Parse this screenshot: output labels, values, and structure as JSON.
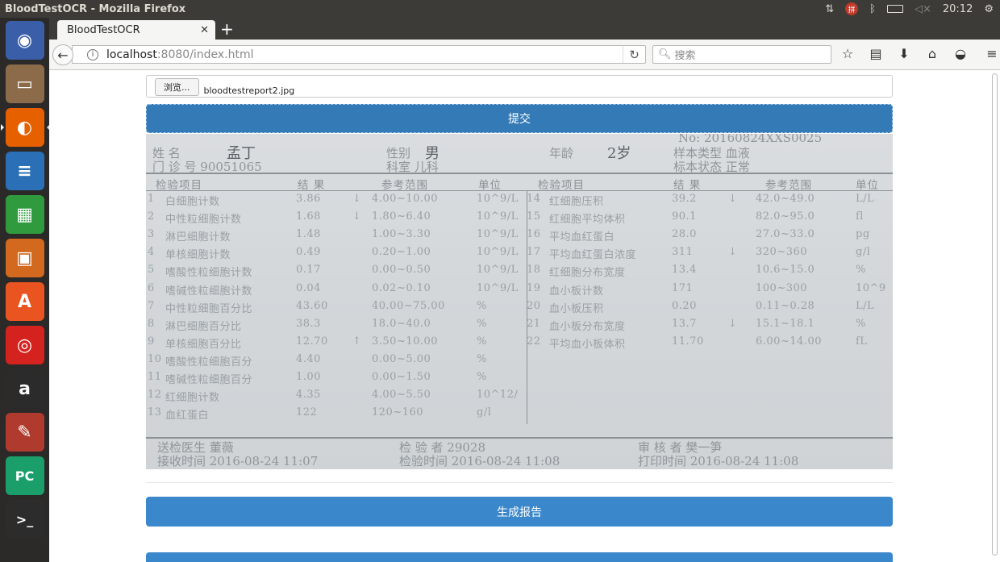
{
  "top_panel": {
    "window_title": "BloodTestOCR - Mozilla Firefox",
    "clock": "20:12",
    "indicators": [
      "network-icon",
      "input-method-icon",
      "bluetooth-icon",
      "battery-icon",
      "volume-muted-icon",
      "settings-gear-icon"
    ]
  },
  "launcher": {
    "apps": [
      {
        "name": "ubuntu-dash",
        "label": "◉",
        "color": "#3a5fa8"
      },
      {
        "name": "files",
        "label": "▭",
        "color": "#8b6b4a"
      },
      {
        "name": "firefox",
        "label": "◐",
        "color": "#e66000"
      },
      {
        "name": "libreoffice-writer",
        "label": "≡",
        "color": "#2b6fb6"
      },
      {
        "name": "libreoffice-calc",
        "label": "▦",
        "color": "#2f9b3e"
      },
      {
        "name": "libreoffice-impress",
        "label": "▣",
        "color": "#d2691e"
      },
      {
        "name": "ubuntu-software",
        "label": "A",
        "color": "#e95420"
      },
      {
        "name": "netease-music",
        "label": "◎",
        "color": "#d4231f"
      },
      {
        "name": "amazon",
        "label": "a",
        "color": "#2b2b2b"
      },
      {
        "name": "system-settings",
        "label": "✎",
        "color": "#b03a2e"
      },
      {
        "name": "pycharm",
        "label": "PC",
        "color": "#1a9f6b"
      },
      {
        "name": "terminal",
        "label": ">_",
        "color": "#2c2c2c"
      }
    ]
  },
  "browser": {
    "tab_title": "BloodTestOCR",
    "new_tab": "+",
    "url_host": "localhost",
    "url_rest": ":8080/index.html",
    "search_placeholder": "搜索"
  },
  "page": {
    "browse_label": "浏览...",
    "file_name": "bloodtestreport2.jpg",
    "submit_label": "提交",
    "generate_label": "生成报告"
  },
  "report_image": {
    "report_no": "No: 20160824XXS0025",
    "name_label": "姓    名",
    "name_value": "孟丁",
    "gender_label": "性别",
    "gender_value": "男",
    "age_label": "年龄",
    "age_value": "2岁",
    "sample_type": "样本类型 血液",
    "clinic_no": "门  诊  号 90051065",
    "department": "科室 儿科",
    "sample_status": "标本状态 正常",
    "headers": {
      "item": "检验项目",
      "result": "结    果",
      "range": "参考范围",
      "unit": "单位"
    },
    "left_rows": [
      {
        "no": "1",
        "name": "白细胞计数",
        "result": "3.86",
        "flag": "↓",
        "range": "4.00~10.00",
        "unit": "10^9/L"
      },
      {
        "no": "2",
        "name": "中性粒细胞计数",
        "result": "1.68",
        "flag": "↓",
        "range": "1.80~6.40",
        "unit": "10^9/L"
      },
      {
        "no": "3",
        "name": "淋巴细胞计数",
        "result": "1.48",
        "flag": "",
        "range": "1.00~3.30",
        "unit": "10^9/L"
      },
      {
        "no": "4",
        "name": "单核细胞计数",
        "result": "0.49",
        "flag": "",
        "range": "0.20~1.00",
        "unit": "10^9/L"
      },
      {
        "no": "5",
        "name": "嗜酸性粒细胞计数",
        "result": "0.17",
        "flag": "",
        "range": "0.00~0.50",
        "unit": "10^9/L"
      },
      {
        "no": "6",
        "name": "嗜碱性粒细胞计数",
        "result": "0.04",
        "flag": "",
        "range": "0.02~0.10",
        "unit": "10^9/L"
      },
      {
        "no": "7",
        "name": "中性粒细胞百分比",
        "result": "43.60",
        "flag": "",
        "range": "40.00~75.00",
        "unit": "%"
      },
      {
        "no": "8",
        "name": "淋巴细胞百分比",
        "result": "38.3",
        "flag": "",
        "range": "18.0~40.0",
        "unit": "%"
      },
      {
        "no": "9",
        "name": "单核细胞百分比",
        "result": "12.70",
        "flag": "↑",
        "range": "3.50~10.00",
        "unit": "%"
      },
      {
        "no": "10",
        "name": "嗜酸性粒细胞百分",
        "result": "4.40",
        "flag": "",
        "range": "0.00~5.00",
        "unit": "%"
      },
      {
        "no": "11",
        "name": "嗜碱性粒细胞百分",
        "result": "1.00",
        "flag": "",
        "range": "0.00~1.50",
        "unit": "%"
      },
      {
        "no": "12",
        "name": "红细胞计数",
        "result": "4.35",
        "flag": "",
        "range": "4.00~5.50",
        "unit": "10^12/"
      },
      {
        "no": "13",
        "name": "血红蛋白",
        "result": "122",
        "flag": "",
        "range": "120~160",
        "unit": "g/l"
      }
    ],
    "right_rows": [
      {
        "no": "14",
        "name": "红细胞压积",
        "result": "39.2",
        "flag": "↓",
        "range": "42.0~49.0",
        "unit": "L/L"
      },
      {
        "no": "15",
        "name": "红细胞平均体积",
        "result": "90.1",
        "flag": "",
        "range": "82.0~95.0",
        "unit": "fl"
      },
      {
        "no": "16",
        "name": "平均血红蛋白",
        "result": "28.0",
        "flag": "",
        "range": "27.0~33.0",
        "unit": "pg"
      },
      {
        "no": "17",
        "name": "平均血红蛋白浓度",
        "result": "311",
        "flag": "↓",
        "range": "320~360",
        "unit": "g/l"
      },
      {
        "no": "18",
        "name": "红细胞分布宽度",
        "result": "13.4",
        "flag": "",
        "range": "10.6~15.0",
        "unit": "%"
      },
      {
        "no": "19",
        "name": "血小板计数",
        "result": "171",
        "flag": "",
        "range": "100~300",
        "unit": "10^9"
      },
      {
        "no": "20",
        "name": "血小板压积",
        "result": "0.20",
        "flag": "",
        "range": "0.11~0.28",
        "unit": "L/L"
      },
      {
        "no": "21",
        "name": "血小板分布宽度",
        "result": "13.7",
        "flag": "↓",
        "range": "15.1~18.1",
        "unit": "%"
      },
      {
        "no": "22",
        "name": "平均血小板体积",
        "result": "11.70",
        "flag": "",
        "range": "6.00~14.00",
        "unit": "fL"
      }
    ],
    "footer": {
      "sender": "送检医生 董薇",
      "receive_time": "接收时间 2016-08-24 11:07",
      "tester": "检  验  者 29028",
      "test_time": "检验时间 2016-08-24 11:08",
      "reviewer": "审  核  者 樊一笋",
      "print_time": "打印时间 2016-08-24 11:08"
    }
  }
}
